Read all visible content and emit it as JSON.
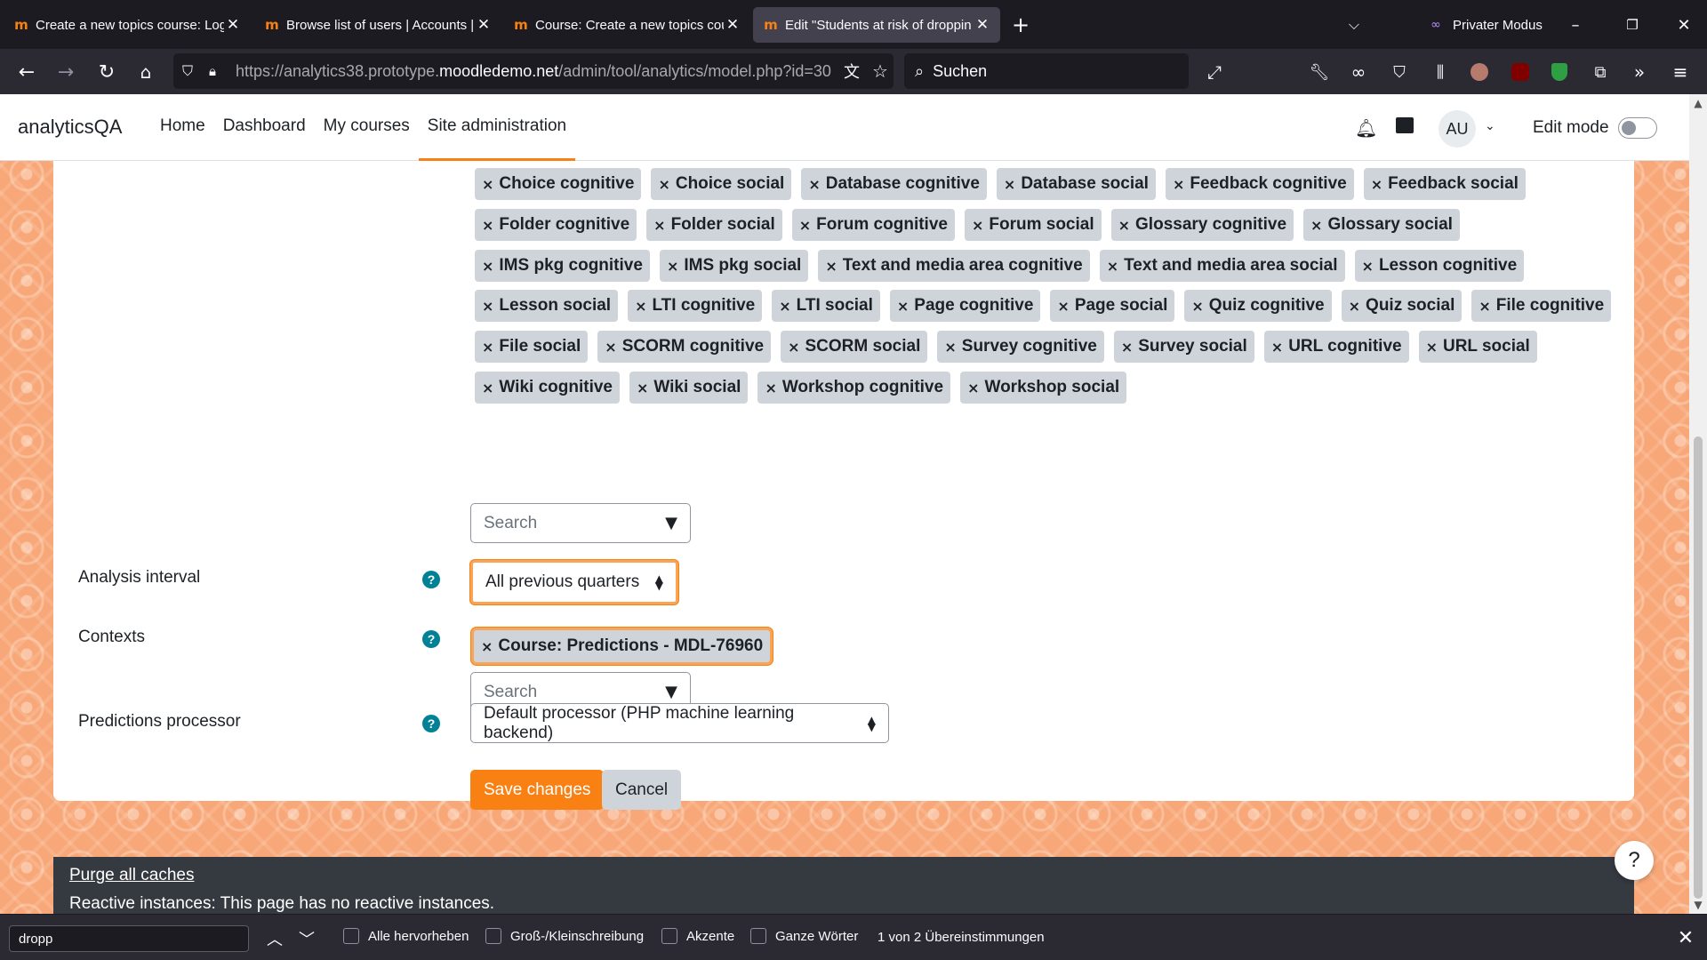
{
  "browser": {
    "tabs": [
      {
        "title": "Create a new topics course: Log",
        "active": false
      },
      {
        "title": "Browse list of users | Accounts |",
        "active": false
      },
      {
        "title": "Course: Create a new topics cou",
        "active": false
      },
      {
        "title": "Edit \"Students at risk of droppin",
        "active": true
      }
    ],
    "favicon_glyph": "m",
    "close_glyph": "✕",
    "new_tab_glyph": "+",
    "private_mode_label": "Privater Modus",
    "url": {
      "prefix": "https://analytics38.prototype.",
      "host": "moodledemo.net",
      "path": "/admin/tool/analytics/model.php?id=30"
    },
    "search_placeholder": "Suchen",
    "colors": {
      "tab_bar": "#1c1b22",
      "toolbar": "#2b2a33"
    }
  },
  "site": {
    "name": "analyticsQA",
    "nav": [
      {
        "label": "Home",
        "active": false
      },
      {
        "label": "Dashboard",
        "active": false
      },
      {
        "label": "My courses",
        "active": false
      },
      {
        "label": "Site administration",
        "active": true
      }
    ],
    "avatar_initials": "AU",
    "edit_mode_label": "Edit mode",
    "colors": {
      "brand": "#f98012",
      "chip": "#ced4da",
      "help": "#008196"
    }
  },
  "form": {
    "indicator_rows": [
      [
        "Choice cognitive",
        "Choice social",
        "Database cognitive",
        "Database social",
        "Feedback cognitive",
        "Feedback social"
      ],
      [
        "Folder cognitive",
        "Folder social",
        "Forum cognitive",
        "Forum social",
        "Glossary cognitive",
        "Glossary social"
      ],
      [
        "IMS pkg cognitive",
        "IMS pkg social",
        "Text and media area cognitive",
        "Text and media area social",
        "Lesson cognitive"
      ],
      [
        "Lesson social",
        "LTI cognitive",
        "LTI social",
        "Page cognitive",
        "Page social",
        "Quiz cognitive",
        "Quiz social",
        "File cognitive"
      ],
      [
        "File social",
        "SCORM cognitive",
        "SCORM social",
        "Survey cognitive",
        "Survey social",
        "URL cognitive",
        "URL social"
      ],
      [
        "Wiki cognitive",
        "Wiki social",
        "Workshop cognitive",
        "Workshop social"
      ]
    ],
    "chip_remove_glyph": "×",
    "indicators_search_placeholder": "Search",
    "analysis_interval": {
      "label": "Analysis interval",
      "value": "All previous quarters"
    },
    "contexts": {
      "label": "Contexts",
      "chip": "Course: Predictions - MDL-76960",
      "search_placeholder": "Search"
    },
    "predictions_processor": {
      "label": "Predictions processor",
      "value": "Default processor (PHP machine learning backend)"
    },
    "help_glyph": "?",
    "save_label": "Save changes",
    "cancel_label": "Cancel"
  },
  "footer": {
    "purge_label": "Purge all caches",
    "reactive_text": "Reactive instances: This page has no reactive instances.",
    "help_fab": "?"
  },
  "findbar": {
    "query": "dropp",
    "options": [
      "Alle hervorheben",
      "Groß-/Kleinschreibung",
      "Akzente",
      "Ganze Wörter"
    ],
    "status": "1 von 2 Übereinstimmungen"
  }
}
